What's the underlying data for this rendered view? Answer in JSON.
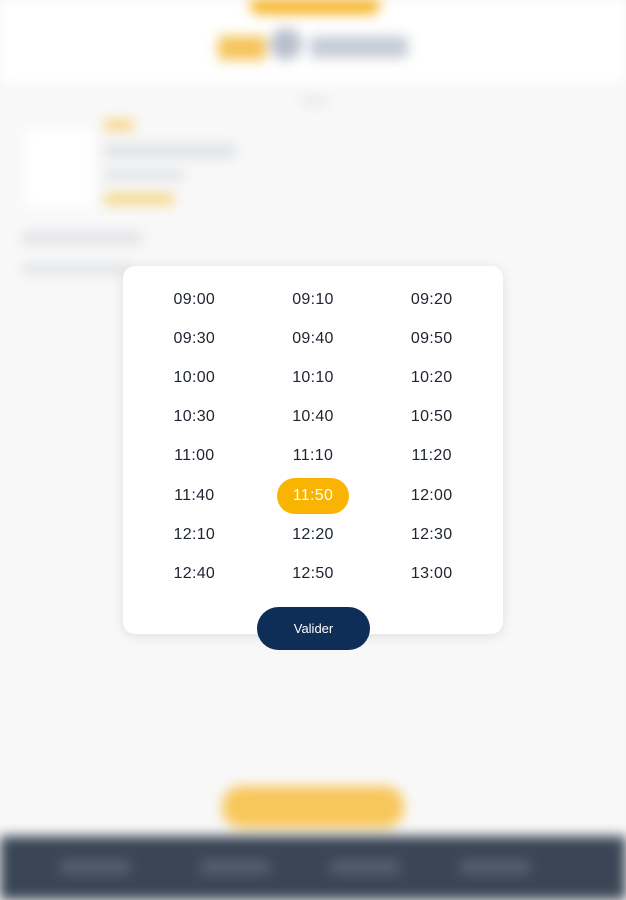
{
  "time_picker": {
    "slots": [
      "09:00",
      "09:10",
      "09:20",
      "09:30",
      "09:40",
      "09:50",
      "10:00",
      "10:10",
      "10:20",
      "10:30",
      "10:40",
      "10:50",
      "11:00",
      "11:10",
      "11:20",
      "11:40",
      "11:50",
      "12:00",
      "12:10",
      "12:20",
      "12:30",
      "12:40",
      "12:50",
      "13:00"
    ],
    "selected": "11:50",
    "selected_color": "#f8b400",
    "validate_label": "Valider",
    "validate_color": "#0f2e57"
  }
}
